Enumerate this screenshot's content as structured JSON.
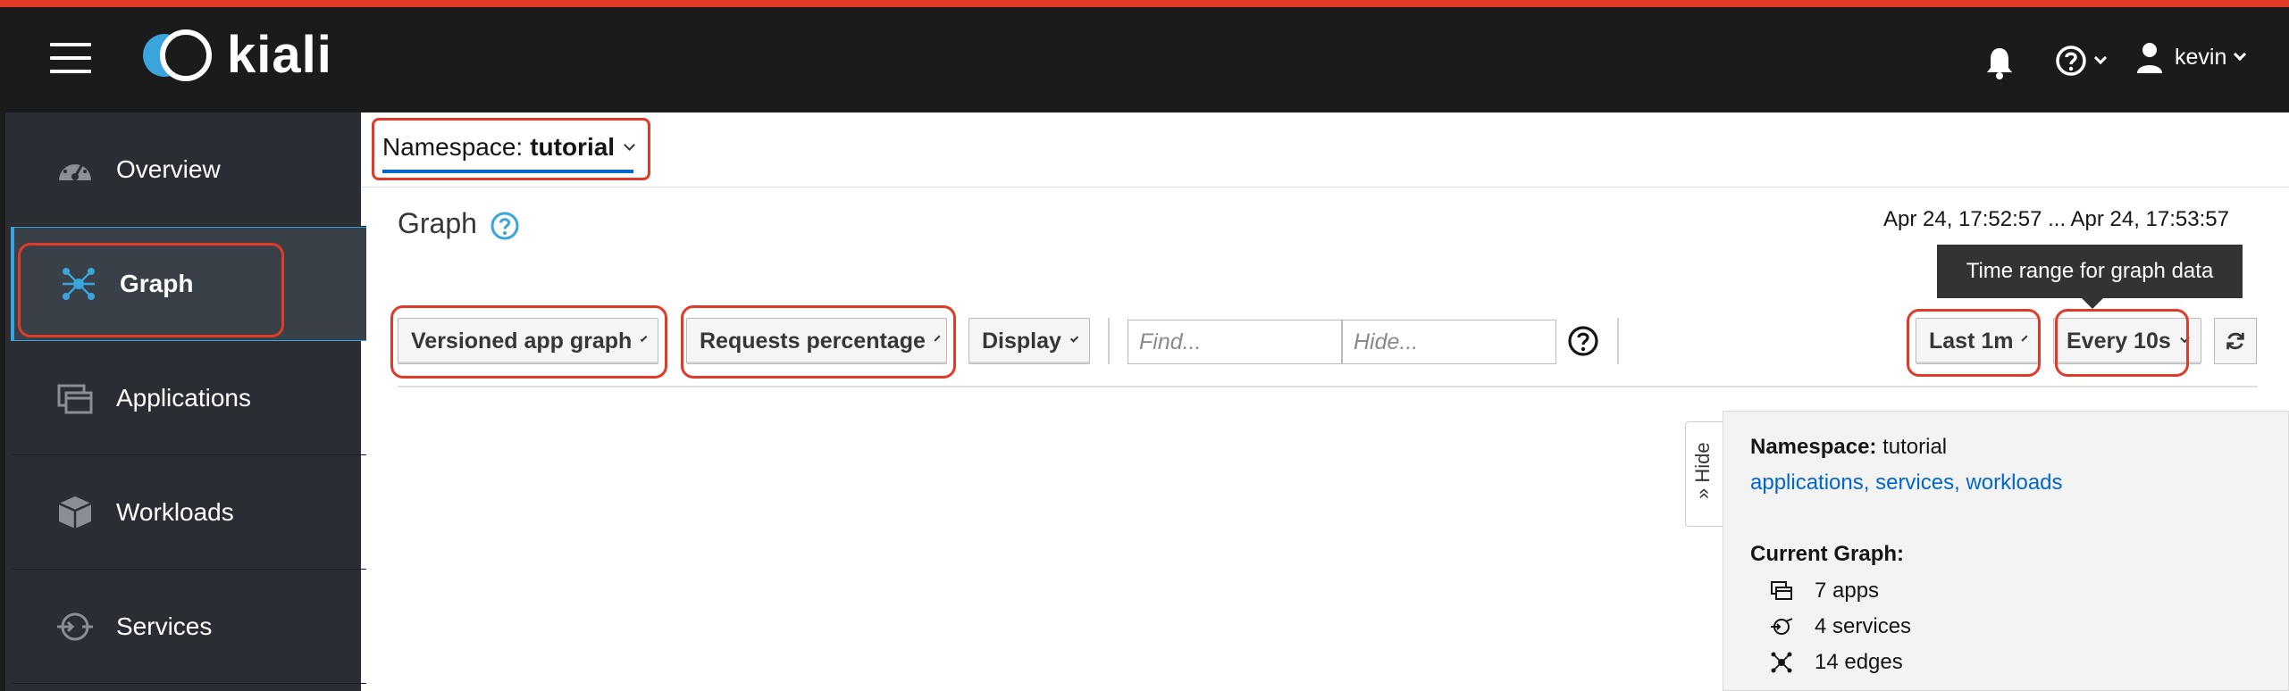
{
  "app": {
    "brand": "kiali"
  },
  "masthead": {
    "user": "kevin"
  },
  "sidebar": {
    "items": [
      {
        "label": "Overview",
        "icon": "dashboard-icon"
      },
      {
        "label": "Graph",
        "icon": "topology-icon",
        "active": true
      },
      {
        "label": "Applications",
        "icon": "applications-icon"
      },
      {
        "label": "Workloads",
        "icon": "workloads-icon"
      },
      {
        "label": "Services",
        "icon": "services-icon"
      }
    ]
  },
  "namespace": {
    "prefix": "Namespace:",
    "value": "tutorial"
  },
  "page": {
    "title": "Graph",
    "time_range": "Apr 24, 17:52:57 ... Apr 24, 17:53:57",
    "tooltip": "Time range for graph data"
  },
  "toolbar": {
    "graph_type": "Versioned app graph",
    "edge_labels": "Requests percentage",
    "display": "Display",
    "find_placeholder": "Find...",
    "hide_placeholder": "Hide...",
    "duration": "Last 1m",
    "refresh_interval": "Every 10s"
  },
  "summary": {
    "hide_label": "» Hide",
    "namespace_label": "Namespace:",
    "namespace_value": "tutorial",
    "links": [
      "applications",
      "services",
      "workloads"
    ],
    "current_graph_label": "Current Graph:",
    "stats": [
      "7 apps",
      "4 services",
      "14 edges"
    ]
  },
  "colors": {
    "accent": "#39a5dc",
    "highlight": "#e03a29",
    "link": "#0066cc",
    "masthead": "#1b1b1b",
    "sidebar": "#2a2e34"
  }
}
